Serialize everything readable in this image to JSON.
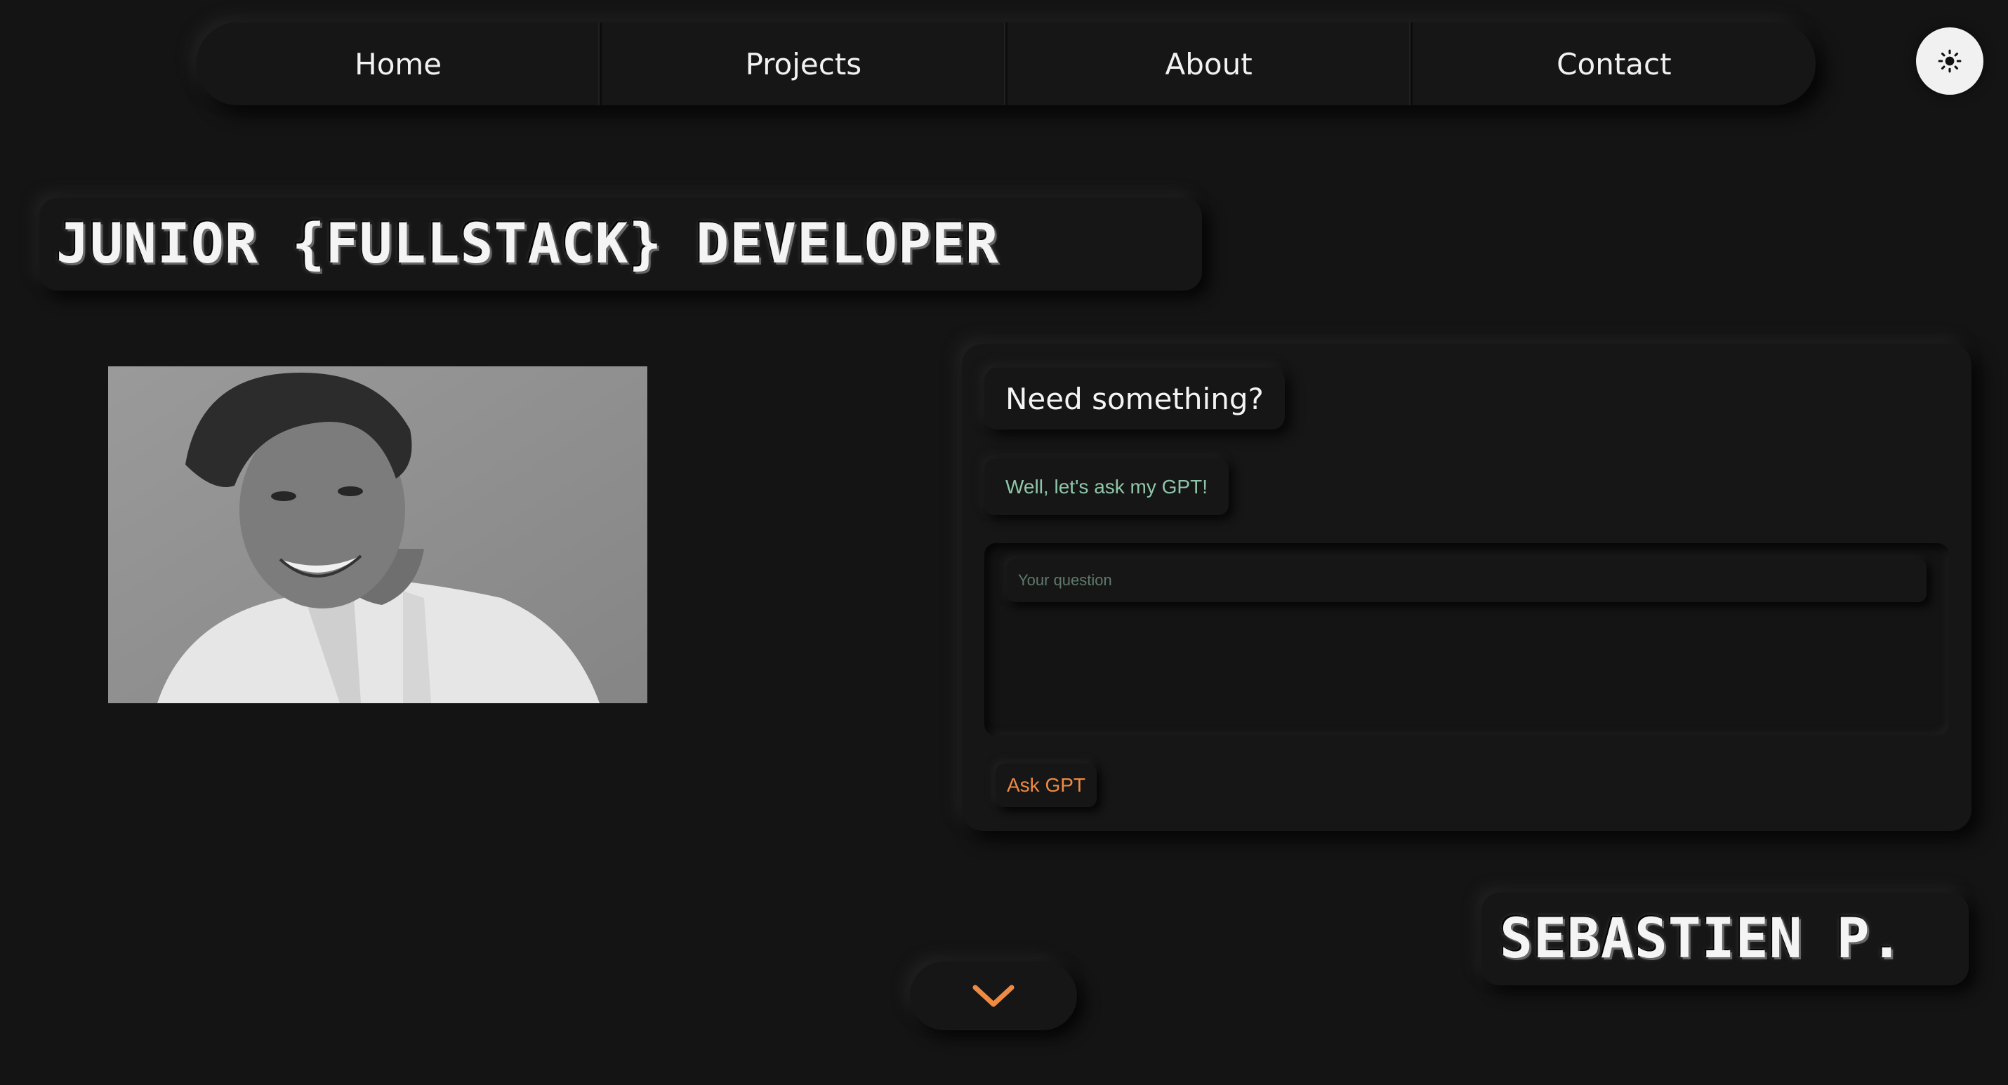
{
  "nav": {
    "items": [
      {
        "label": "Home"
      },
      {
        "label": "Projects"
      },
      {
        "label": "About"
      },
      {
        "label": "Contact"
      }
    ],
    "theme_toggle_icon": "sun-icon"
  },
  "hero": {
    "role_title": "JUNIOR {FULLSTACK} DEVELOPER",
    "name": "SEBASTIEN P."
  },
  "chat": {
    "heading": "Need something?",
    "subheading": "Well, let's ask my GPT!",
    "input_placeholder": "Your question",
    "input_value": "",
    "button_label": "Ask GPT"
  },
  "scroll": {
    "icon": "chevron-down-icon"
  },
  "colors": {
    "background": "#141414",
    "accent": "#ef8a43",
    "subtext": "#8fc6a9",
    "text": "#ffffff"
  }
}
